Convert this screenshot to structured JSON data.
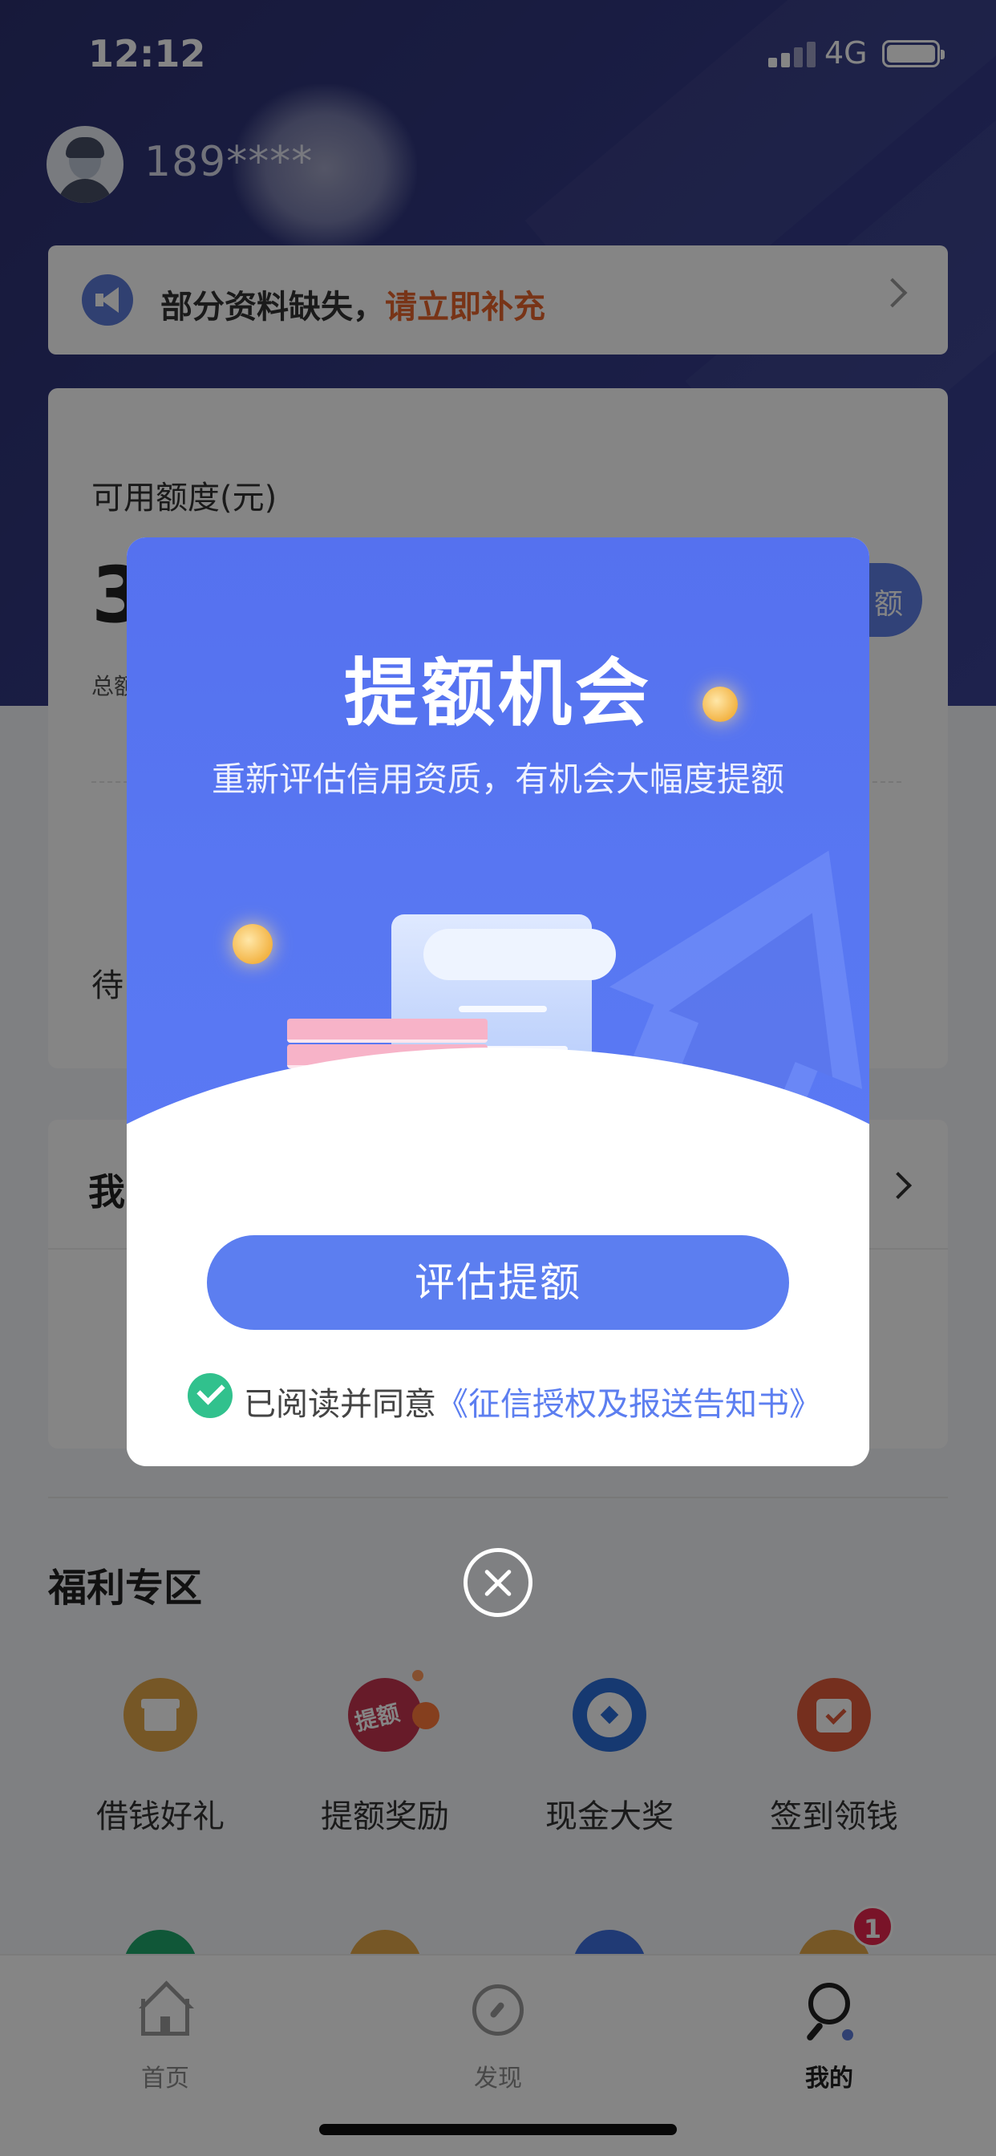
{
  "status_bar": {
    "time": "12:12",
    "network": "4G"
  },
  "header": {
    "phone_masked": "189****"
  },
  "notice": {
    "text": "部分资料缺失，",
    "link": "请立即补充"
  },
  "credit": {
    "label": "可用额度(元)",
    "amount_partial": "3",
    "total_partial": "总额",
    "raise_button_partial": "额",
    "pending_partial": "待"
  },
  "loan_section": {
    "title_partial": "我"
  },
  "welfare": {
    "title": "福利专区",
    "items": [
      {
        "label": "借钱好礼",
        "icon": "gift-icon",
        "color": "#e3a84a"
      },
      {
        "label": "提额奖励",
        "icon": "raise-badge-icon",
        "icon_text": "提额",
        "color": "#c6354f"
      },
      {
        "label": "现金大奖",
        "icon": "cash-prize-icon",
        "color": "#2b6dd9"
      },
      {
        "label": "签到领钱",
        "icon": "sign-in-icon",
        "color": "#e05a3a"
      }
    ]
  },
  "tabbar": {
    "tabs": [
      {
        "label": "首页",
        "icon": "home-icon",
        "active": false
      },
      {
        "label": "发现",
        "icon": "compass-icon",
        "active": false
      },
      {
        "label": "我的",
        "icon": "search-person-icon",
        "active": true
      }
    ],
    "badge_count": "1"
  },
  "modal": {
    "title": "提额机会",
    "subtitle": "重新评估信用资质，有机会大幅度提额",
    "cta": "评估提额",
    "agree_text": "已阅读并同意",
    "agree_link": "《征信授权及报送告知书》",
    "coin_symbol": "¥",
    "hero_color": "#5877f2",
    "accent_color": "#5c7ef0"
  }
}
